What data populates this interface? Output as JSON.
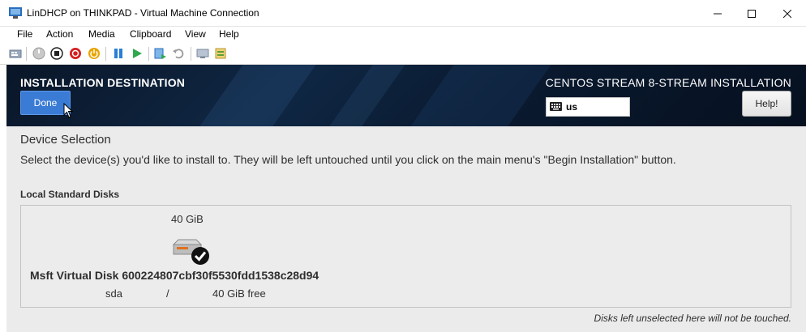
{
  "window": {
    "title": "LinDHCP on THINKPAD - Virtual Machine Connection",
    "icon": "vm-connection-icon",
    "controls": [
      "minimize-icon",
      "maximize-icon",
      "close-icon"
    ]
  },
  "menu": {
    "items": [
      "File",
      "Action",
      "Media",
      "Clipboard",
      "View",
      "Help"
    ]
  },
  "toolbar": {
    "icons": [
      "ctrl-alt-del-icon",
      "start-icon",
      "turn-off-icon",
      "shutdown-icon",
      "power-icon",
      "pause-icon",
      "resume-icon",
      "checkpoint-icon",
      "revert-icon",
      "enhanced-session-icon",
      "share-icon"
    ]
  },
  "installer": {
    "page_title": "INSTALLATION DESTINATION",
    "product_title": "CENTOS STREAM 8-STREAM INSTALLATION",
    "done_label": "Done",
    "keyboard_layout": "us",
    "help_label": "Help!",
    "colors": {
      "header_bg": "#0f2744",
      "done_button": "#3a7bd5",
      "content_bg": "#ebebeb"
    }
  },
  "device_selection": {
    "title": "Device Selection",
    "description": "Select the device(s) you'd like to install to.  They will be left untouched until you click on the main menu's \"Begin Installation\" button.",
    "local_disks_heading": "Local Standard Disks",
    "disk": {
      "size": "40 GiB",
      "name": "Msft Virtual Disk 600224807cbf30f5530fdd1538c28d94",
      "device": "sda",
      "mount": "/",
      "free": "40 GiB free",
      "selected": true
    },
    "footnote": "Disks left unselected here will not be touched."
  }
}
